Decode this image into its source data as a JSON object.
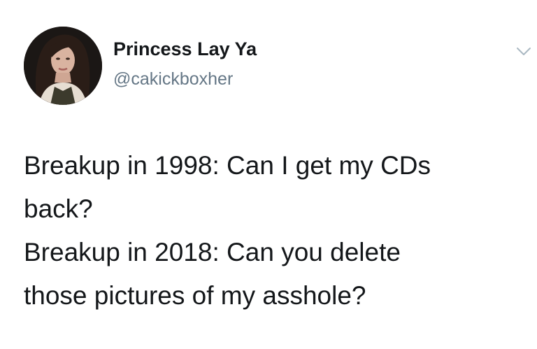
{
  "author": {
    "display_name": "Princess Lay Ya",
    "handle": "@cakickboxher",
    "avatar_icon": "profile-photo"
  },
  "menu_icon": "chevron-down-icon",
  "tweet": {
    "lines": [
      "Breakup in 1998: Can I get my CDs",
      "back?",
      "Breakup in 2018: Can you delete",
      "those pictures of my asshole?"
    ]
  },
  "colors": {
    "text": "#14171a",
    "secondary_text": "#657786",
    "chevron": "#aab8c2",
    "background": "#ffffff"
  }
}
